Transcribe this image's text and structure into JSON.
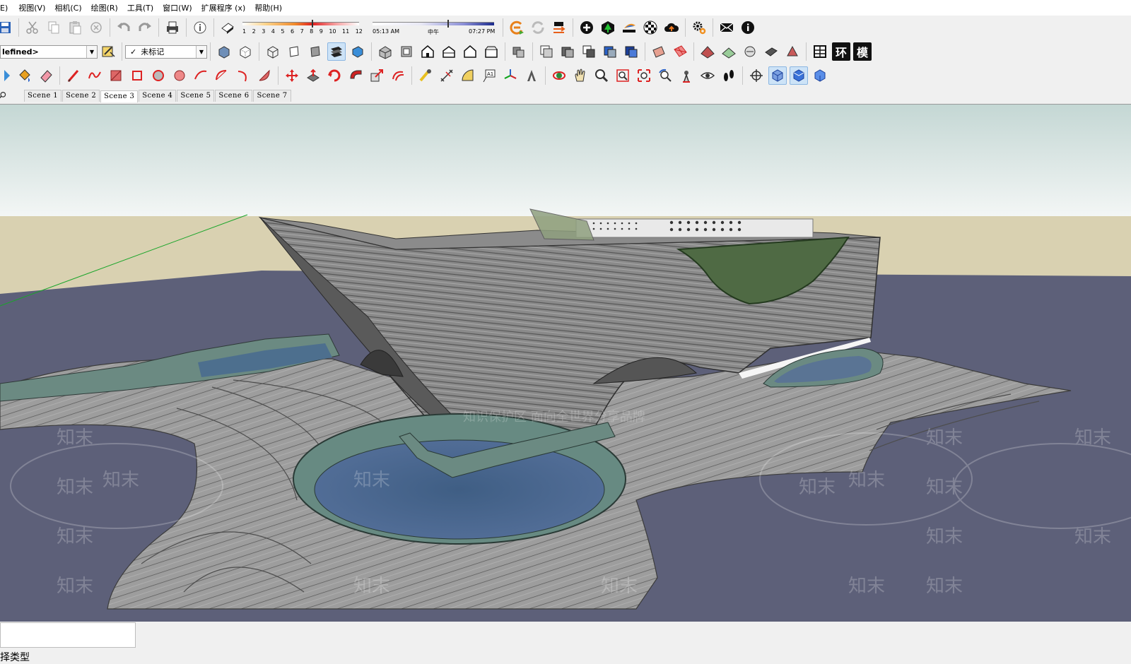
{
  "menubar": {
    "items": [
      "E)",
      "视图(V)",
      "相机(C)",
      "绘图(R)",
      "工具(T)",
      "窗口(W)",
      "扩展程序 (x)",
      "帮助(H)"
    ]
  },
  "shadow": {
    "months": [
      "1",
      "2",
      "3",
      "4",
      "5",
      "6",
      "7",
      "8",
      "9",
      "10",
      "11",
      "12"
    ],
    "time_start": "05:13 AM",
    "time_mid": "中午",
    "time_end": "07:27 PM"
  },
  "toolbar2": {
    "style_combo": "lefined>",
    "tag_combo": "未标记",
    "tag_check": "✓",
    "text_icons": [
      "环",
      "模"
    ]
  },
  "scenes": {
    "tabs": [
      "Scene 1",
      "Scene 2",
      "Scene 3",
      "Scene 4",
      "Scene 5",
      "Scene 6",
      "Scene 7"
    ],
    "active_index": 2
  },
  "watermark": {
    "text": "知末",
    "caption": "知识保护区 面向全世界分享品牌"
  },
  "status": {
    "hint": "择类型"
  },
  "colors": {
    "sky_top": "#c8d9d6",
    "sky_bottom": "#f3f5f4",
    "ground": "#d9d1b1",
    "water_plane": "#5c5f7b",
    "axis_green": "#1aa52a"
  }
}
